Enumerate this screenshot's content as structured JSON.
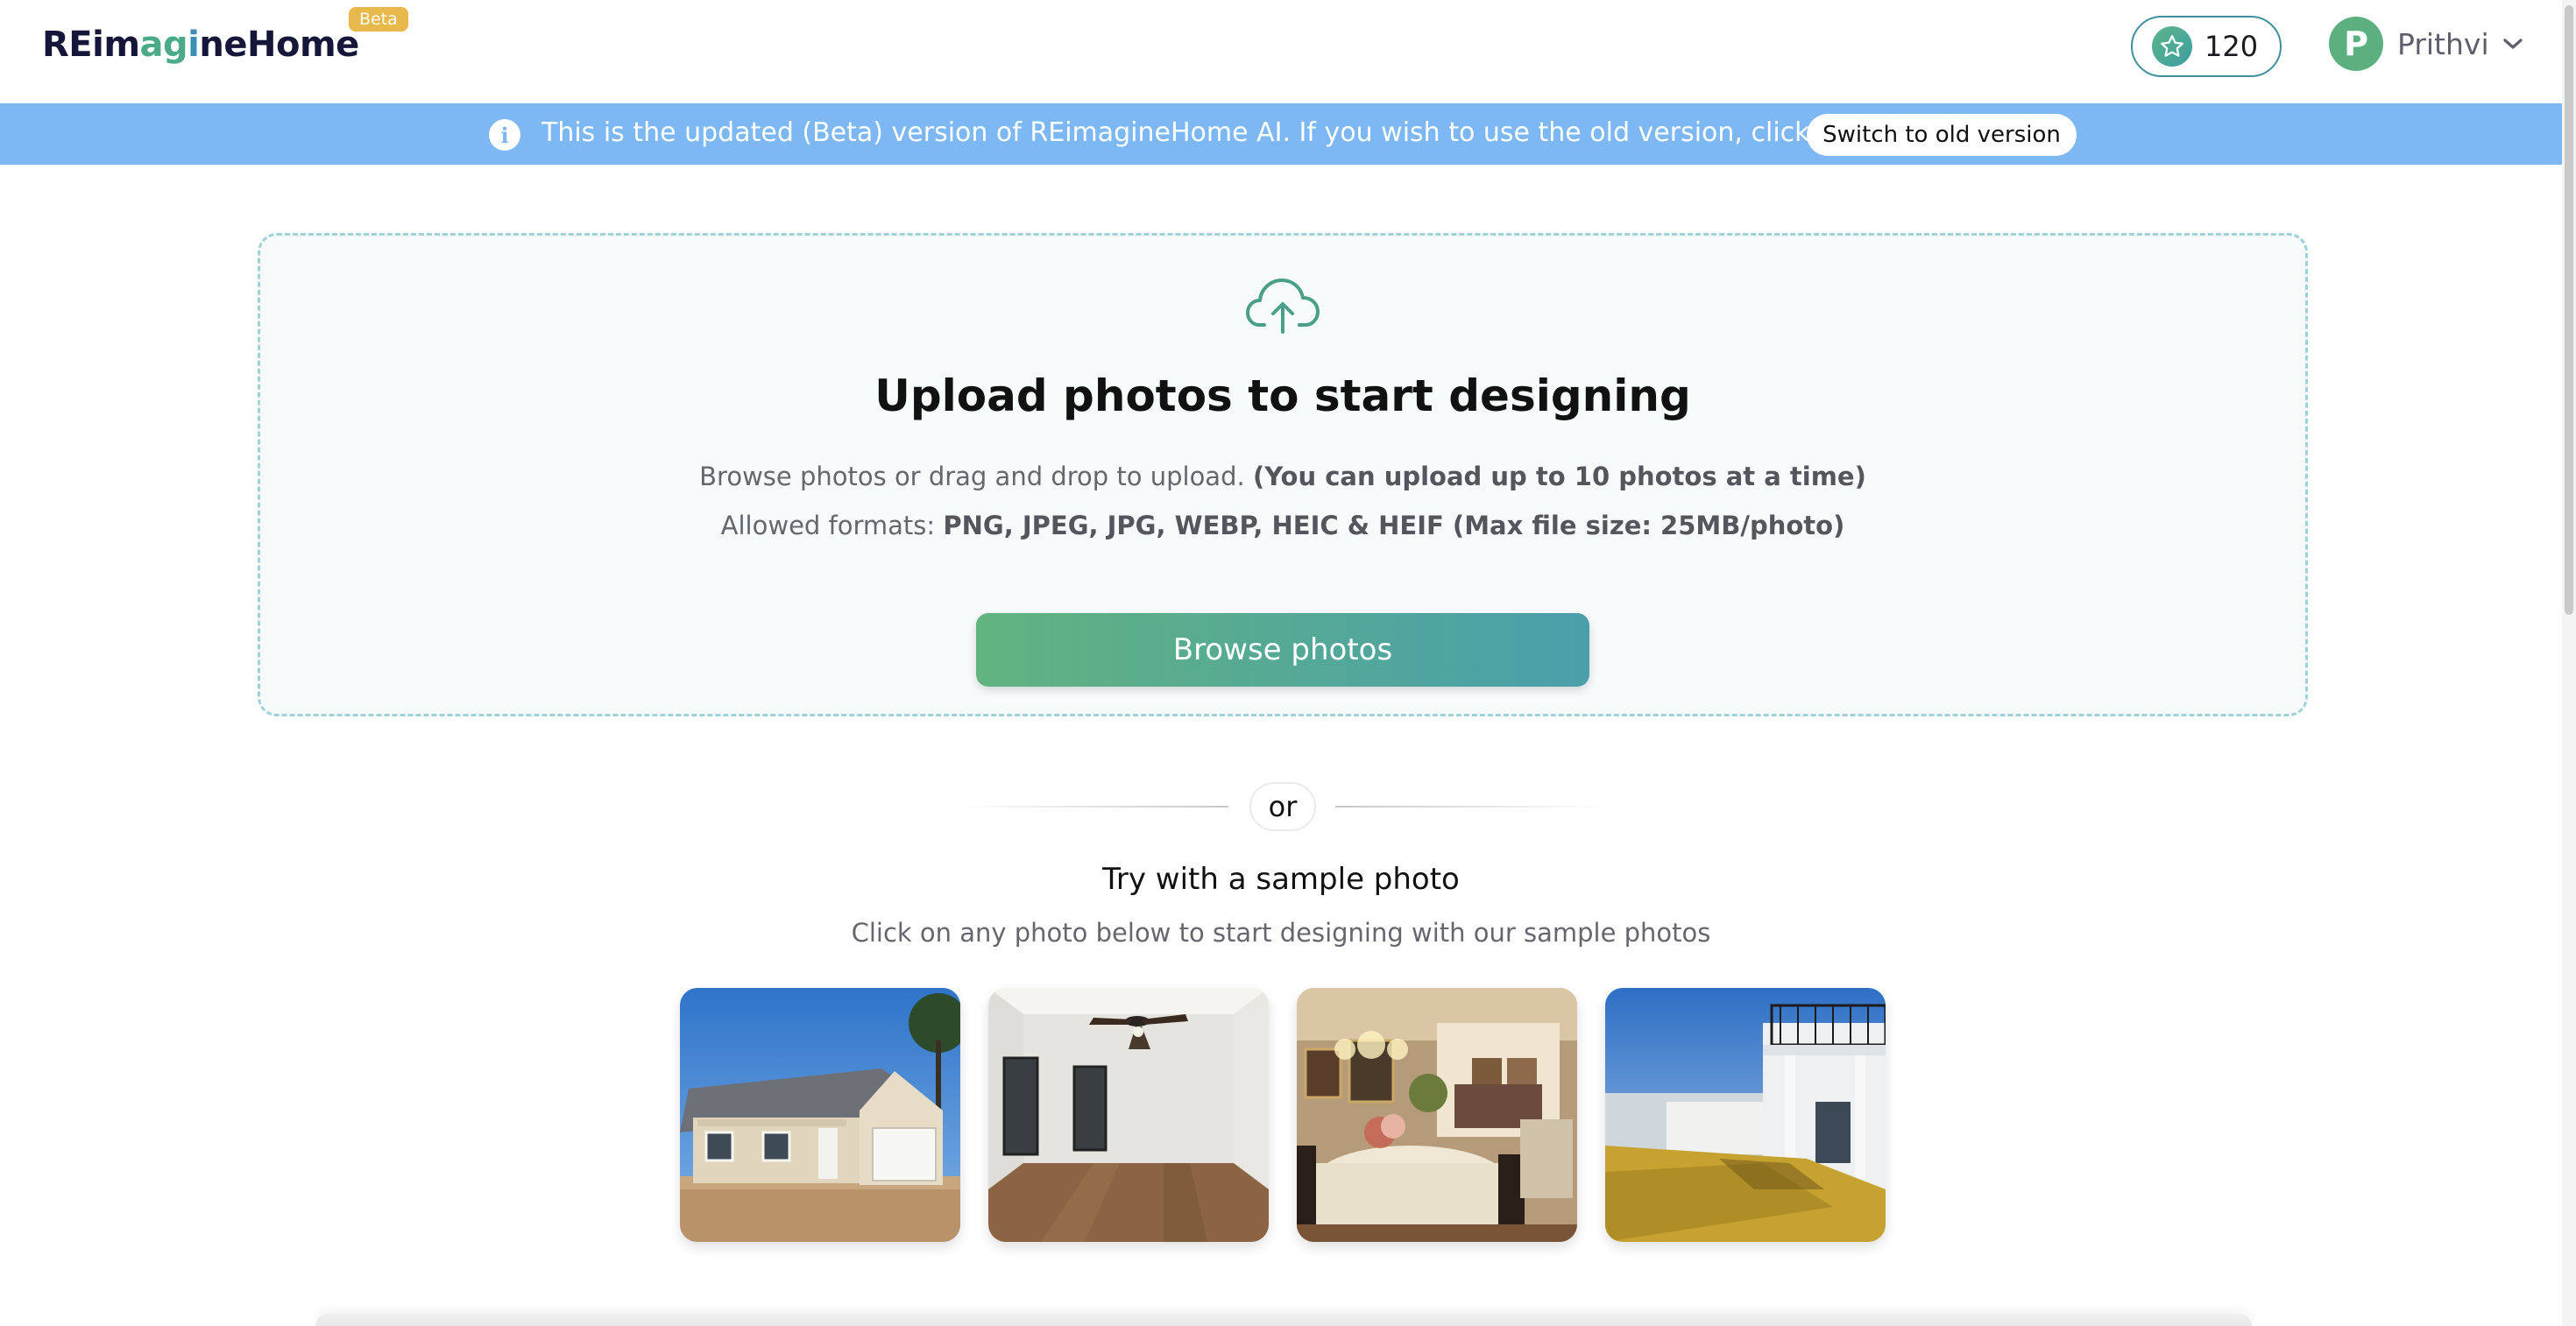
{
  "header": {
    "logo": {
      "part1": "REim",
      "part2": "a",
      "part3": "g",
      "part4": "i",
      "part5": "neHome"
    },
    "beta_badge": "Beta",
    "credits": {
      "icon": "star-icon",
      "count": "120"
    },
    "user": {
      "initial": "P",
      "name": "Prithvi",
      "icon": "chevron-down-icon"
    }
  },
  "banner": {
    "icon": "info-icon",
    "text": "This is the updated (Beta) version of REimagineHome AI. If you wish to use the old version, click here",
    "button": "Switch to old version"
  },
  "upload": {
    "icon": "cloud-upload-icon",
    "title": "Upload photos to start designing",
    "subtitle_prefix": "Browse photos or drag and drop to upload. ",
    "subtitle_bold": "(You can upload up to 10 photos at a time)",
    "formats_prefix": "Allowed formats:  ",
    "formats_bold": "PNG, JPEG, JPG, WEBP, HEIC & HEIF (Max file size: 25MB/photo)",
    "button": "Browse photos"
  },
  "divider": {
    "text": "or"
  },
  "samples": {
    "title": "Try with a sample photo",
    "subtitle": "Click on any photo below to start designing with our sample photos"
  },
  "colors": {
    "brand_green": "#4bab89",
    "banner_blue": "#7db8f4",
    "button_gradient_start": "#61b37f",
    "button_gradient_end": "#4a9fab",
    "beta_yellow": "#e7b84a"
  }
}
